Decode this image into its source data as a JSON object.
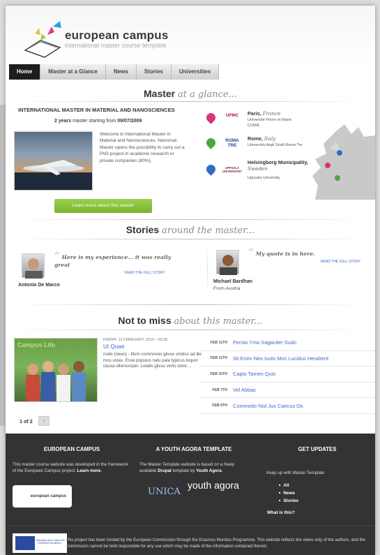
{
  "header": {
    "brand": "european campus",
    "tagline": "international master course template"
  },
  "nav": [
    "Home",
    "Master at a Glance",
    "News",
    "Stories",
    "Universities"
  ],
  "master": {
    "title_main": "Master",
    "title_sub": "at a glance...",
    "program_title": "INTERNATIONAL MASTER IN MATERIAL AND NANOSCIENCES",
    "years_prefix": "2 years",
    "years_mid": "master starting from",
    "start_date": "09/07/2009",
    "welcome": "Welcome to International Master in Material and Nanosciences. Nanomat-Master opens the possibility to carry out a PhD project in academic research or private companies (80%).",
    "learn_more": "Learn more about this master",
    "locations": [
      {
        "city": "Paris,",
        "country": "France",
        "university": "Université Pierre et Marie CURIE",
        "logo": "UPMC",
        "pin_color": "#d6347c"
      },
      {
        "city": "Rome,",
        "country": "Italy",
        "university": "Università degli Studi Roma Tre",
        "logo": "ROMA TRE",
        "pin_color": "#4aa83c"
      },
      {
        "city": "Helsingborg Municipality,",
        "country": "Sweden",
        "university": "Uppsala University",
        "logo": "UPPSALA UNIVERSITET",
        "pin_color": "#2f6fc4"
      }
    ]
  },
  "stories": {
    "title_main": "Stories",
    "title_sub": "around the master...",
    "items": [
      {
        "quote": "Here is my experience... it was really great",
        "link": "READ THE FULL STORY",
        "name": "Antonio De Marco",
        "from": ""
      },
      {
        "quote": "My quote is in here.",
        "link": "READ THE FULL STORY",
        "name": "Michael Bardhan",
        "from": "From Austria"
      }
    ]
  },
  "news": {
    "title_main": "Not to miss",
    "title_sub": "about this master...",
    "image_label_a": "Campus",
    "image_label_b": "Life",
    "date": "FRIDAY, 12 FEBRUARY, 2010 – 03:38",
    "title": "Ut Quae",
    "text": "node (news) - Illum commoveo gilvus vindico ad ille mos ustas. Esse populus natu pala typicus loquor causa ullamcorper. Letalis gilvus verto dolor....",
    "events": [
      {
        "date": "FEB 11TH",
        "title": "Persto Ymo Sagaciter Sudo"
      },
      {
        "date": "FEB 11TH",
        "title": "Sit Enim Neo Iusto Mos Lucidus Hendrerit"
      },
      {
        "date": "FEB 10TH",
        "title": "Capto Tamen Quis"
      },
      {
        "date": "FEB 7TH",
        "title": "Vel Abbas"
      },
      {
        "date": "FEB 6TH",
        "title": "Commodo Nisl Jus Caecus Os"
      }
    ],
    "pager": "1 of 2",
    "pager_next": "›"
  },
  "footer": {
    "col1_head": "EUROPEAN CAMPUS",
    "col1_text": "This master course website was developed in the framework of the European Campus project.",
    "col1_link": "Learn more.",
    "col1_logo": "european campus",
    "col2_head": "A YOUTH AGORA TEMPLATE",
    "col2_text_a": "The Master Template website is based on a freely available",
    "col2_bold1": "Drupal",
    "col2_text_b": "template by",
    "col2_bold2": "Youth Agora",
    "col2_logo1": "UNICA",
    "col2_logo2": "youth agora",
    "col3_head": "GET UPDATES",
    "col3_text": "Keep up with Master Template",
    "col3_items": [
      "All",
      "News",
      "Stories"
    ],
    "col3_what": "What is this?",
    "disclaimer": "This project has been funded by the European Commission through the Erasmus Mundus Programme. This website reflects the views only of the authors, and the Commission cannot be held responsible for any use which may be made of the information contained therein.",
    "eu_label": "Education and Culture DG · ERASMUS MUNDUS"
  }
}
